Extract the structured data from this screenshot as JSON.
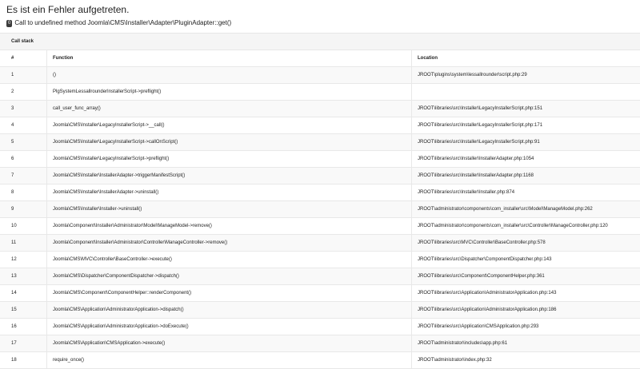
{
  "error": {
    "title": "Es ist ein Fehler aufgetreten.",
    "code_badge": "0",
    "message": "Call to undefined method Joomla\\CMS\\Installer\\Adapter\\PluginAdapter::get()"
  },
  "call_stack": {
    "heading": "Call stack",
    "columns": {
      "num": "#",
      "function": "Function",
      "location": "Location"
    },
    "rows": [
      {
        "num": "1",
        "function": "()",
        "location": "JROOT\\plugins\\system\\lessallrounder\\script.php:29"
      },
      {
        "num": "2",
        "function": "PlgSystemLessallrounderInstallerScript->preflight()",
        "location": ""
      },
      {
        "num": "3",
        "function": "call_user_func_array()",
        "location": "JROOT\\libraries\\src\\Installer\\LegacyInstallerScript.php:151"
      },
      {
        "num": "4",
        "function": "Joomla\\CMS\\Installer\\LegacyInstallerScript->__call()",
        "location": "JROOT\\libraries\\src\\Installer\\LegacyInstallerScript.php:171"
      },
      {
        "num": "5",
        "function": "Joomla\\CMS\\Installer\\LegacyInstallerScript->callOnScript()",
        "location": "JROOT\\libraries\\src\\Installer\\LegacyInstallerScript.php:91"
      },
      {
        "num": "6",
        "function": "Joomla\\CMS\\Installer\\LegacyInstallerScript->preflight()",
        "location": "JROOT\\libraries\\src\\Installer\\InstallerAdapter.php:1054"
      },
      {
        "num": "7",
        "function": "Joomla\\CMS\\Installer\\InstallerAdapter->triggerManifestScript()",
        "location": "JROOT\\libraries\\src\\Installer\\InstallerAdapter.php:1168"
      },
      {
        "num": "8",
        "function": "Joomla\\CMS\\Installer\\InstallerAdapter->uninstall()",
        "location": "JROOT\\libraries\\src\\Installer\\Installer.php:874"
      },
      {
        "num": "9",
        "function": "Joomla\\CMS\\Installer\\Installer->uninstall()",
        "location": "JROOT\\administrator\\components\\com_installer\\src\\Model\\ManageModel.php:262"
      },
      {
        "num": "10",
        "function": "Joomla\\Component\\Installer\\Administrator\\Model\\ManageModel->remove()",
        "location": "JROOT\\administrator\\components\\com_installer\\src\\Controller\\ManageController.php:120"
      },
      {
        "num": "11",
        "function": "Joomla\\Component\\Installer\\Administrator\\Controller\\ManageController->remove()",
        "location": "JROOT\\libraries\\src\\MVC\\Controller\\BaseController.php:578"
      },
      {
        "num": "12",
        "function": "Joomla\\CMS\\MVC\\Controller\\BaseController->execute()",
        "location": "JROOT\\libraries\\src\\Dispatcher\\ComponentDispatcher.php:143"
      },
      {
        "num": "13",
        "function": "Joomla\\CMS\\Dispatcher\\ComponentDispatcher->dispatch()",
        "location": "JROOT\\libraries\\src\\Component\\ComponentHelper.php:361"
      },
      {
        "num": "14",
        "function": "Joomla\\CMS\\Component\\ComponentHelper::renderComponent()",
        "location": "JROOT\\libraries\\src\\Application\\AdministratorApplication.php:143"
      },
      {
        "num": "15",
        "function": "Joomla\\CMS\\Application\\AdministratorApplication->dispatch()",
        "location": "JROOT\\libraries\\src\\Application\\AdministratorApplication.php:186"
      },
      {
        "num": "16",
        "function": "Joomla\\CMS\\Application\\AdministratorApplication->doExecute()",
        "location": "JROOT\\libraries\\src\\Application\\CMSApplication.php:293"
      },
      {
        "num": "17",
        "function": "Joomla\\CMS\\Application\\CMSApplication->execute()",
        "location": "JROOT\\administrator\\includes\\app.php:61"
      },
      {
        "num": "18",
        "function": "require_once()",
        "location": "JROOT\\administrator\\index.php:32"
      }
    ]
  }
}
